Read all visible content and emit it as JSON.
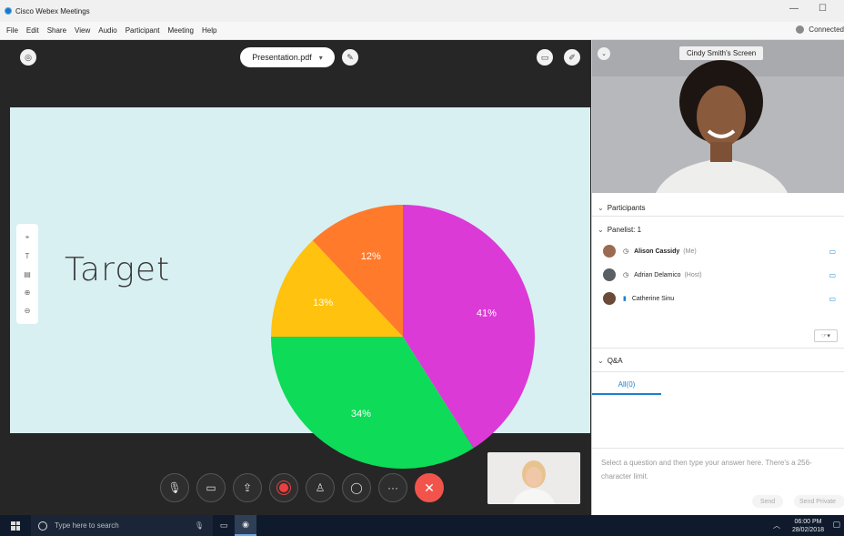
{
  "window": {
    "title": "Cisco Webex Meetings",
    "minimize_glyph": "—",
    "maximize_glyph": "☐"
  },
  "menu": [
    "File",
    "Edit",
    "Share",
    "View",
    "Audio",
    "Participant",
    "Meeting",
    "Help"
  ],
  "status": {
    "connection": "Connected"
  },
  "stage": {
    "shared_file": "Presentation.pdf",
    "slide_title": "Target"
  },
  "chart_data": {
    "type": "pie",
    "labels": [
      "41%",
      "34%",
      "13%",
      "12%"
    ],
    "values": [
      41,
      34,
      13,
      12
    ],
    "colors": [
      "#dc3ad6",
      "#0edb57",
      "#ffc20e",
      "#ff7a2b"
    ]
  },
  "video": {
    "label": "Cindy Smith's Screen"
  },
  "participants": {
    "header": "Participants",
    "panelist_header": "Panelist: 1",
    "list": [
      {
        "name": "Alison Cassidy",
        "role": "(Me)"
      },
      {
        "name": "Adrian Delamico",
        "role": "(Host)"
      },
      {
        "name": "Catherine Sinu",
        "role": ""
      }
    ]
  },
  "qa": {
    "header": "Q&A",
    "tab": "All(0)",
    "placeholder": "Select a question and then type your answer here. There's a 256-character limit.",
    "send_label": "Send",
    "send_private_label": "Send Private"
  },
  "taskbar": {
    "search_placeholder": "Type here to search",
    "time": "06:00 PM",
    "date": "28/02/2018"
  }
}
